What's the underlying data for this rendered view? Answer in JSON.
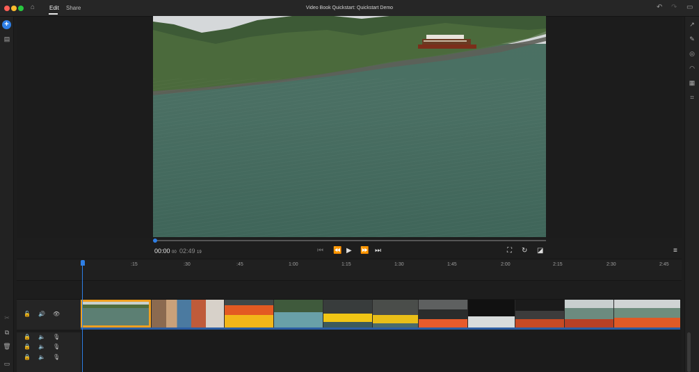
{
  "window": {
    "title": "Video Book Quickstart: Quickstart Demo",
    "tabs": [
      "Edit",
      "Share"
    ]
  },
  "colors": {
    "accent": "#2e7fe6",
    "selection": "#f0a020",
    "close": "#ff5f57",
    "minimize": "#febc2e",
    "maximize": "#28c840"
  },
  "playback": {
    "current_time": "00:00",
    "current_frames": "00",
    "duration": "02:49",
    "duration_frames": "19"
  },
  "timeline": {
    "ruler_labels": [
      ":15",
      ":30",
      ":45",
      "1:00",
      "1:15",
      "1:30",
      "1:45",
      "2:00",
      "2:15",
      "2:30",
      "2:45"
    ]
  },
  "icons": {
    "home": "home-icon",
    "undo": "undo-icon",
    "redo": "redo-icon",
    "feedback": "feedback-icon",
    "add": "add-media-icon",
    "project": "project-panel-icon"
  }
}
